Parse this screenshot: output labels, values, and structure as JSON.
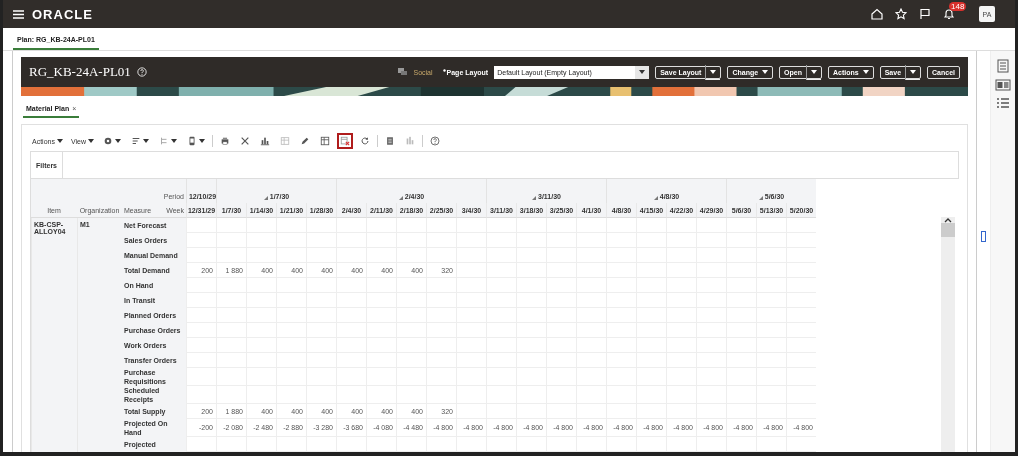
{
  "topbar": {
    "logo": "ORACLE",
    "notification_count": "148",
    "avatar": "PA"
  },
  "plan_tab": {
    "label": "Plan: RG_KB-24A-PL01",
    "selected": true
  },
  "header": {
    "title": "RG_KB-24A-PL01",
    "social": "Social",
    "page_layout": {
      "label": "Page Layout",
      "required": true,
      "value": "Default Layout (Empty Layout)"
    },
    "buttons": [
      {
        "label": "Save Layout",
        "kind": "split"
      },
      {
        "label": "Change",
        "kind": "menu"
      },
      {
        "label": "Open",
        "kind": "split"
      },
      {
        "label": "Actions",
        "kind": "menu"
      },
      {
        "label": "Save",
        "kind": "split"
      },
      {
        "label": "Cancel",
        "kind": "plain"
      }
    ]
  },
  "content_tab": {
    "label": "Material Plan",
    "close": "×",
    "selected": true
  },
  "toolbar": {
    "menus": [
      {
        "label": "Actions"
      },
      {
        "label": "View"
      }
    ],
    "icons": [
      {
        "highlighted": false
      },
      {
        "highlighted": false
      },
      {
        "highlighted": false
      },
      {
        "highlighted": false
      },
      {
        "highlighted": false
      },
      {
        "highlighted": false
      },
      {
        "highlighted": false
      },
      {
        "highlighted": false
      },
      {
        "highlighted": false
      },
      {
        "highlighted": false
      },
      {
        "highlighted": true
      },
      {
        "highlighted": false
      },
      {
        "highlighted": false
      },
      {
        "highlighted": false
      },
      {
        "highlighted": false
      }
    ]
  },
  "filters": {
    "label": "Filters"
  },
  "table": {
    "period_label": "Period",
    "columns": [
      "Item",
      "Organization",
      "Measure",
      "Week"
    ],
    "periods": [
      {
        "label": "12/10/29",
        "weeks": [
          "12/31/29"
        ]
      },
      {
        "label": "1/7/30",
        "weeks": [
          "1/7/30",
          "1/14/30",
          "1/21/30",
          "1/28/30"
        ]
      },
      {
        "label": "2/4/30",
        "weeks": [
          "2/4/30",
          "2/11/30",
          "2/18/30",
          "2/25/30",
          "3/4/30"
        ]
      },
      {
        "label": "3/11/30",
        "weeks": [
          "3/11/30",
          "3/18/30",
          "3/25/30",
          "4/1/30"
        ]
      },
      {
        "label": "4/8/30",
        "weeks": [
          "4/8/30",
          "4/15/30",
          "4/22/30",
          "4/29/30"
        ]
      },
      {
        "label": "5/6/30",
        "weeks": [
          "5/6/30",
          "5/13/30",
          "5/20/30"
        ]
      }
    ],
    "item": "KB-CSP-ALLOY04",
    "organization": "M1",
    "measures": [
      {
        "name": "Net Forecast"
      },
      {
        "name": "Sales Orders"
      },
      {
        "name": "Manual Demand"
      },
      {
        "name": "Total Demand",
        "values": [
          "200",
          "1 880",
          "400",
          "400",
          "400",
          "400",
          "400",
          "400",
          "320"
        ]
      },
      {
        "name": "On Hand"
      },
      {
        "name": "In Transit"
      },
      {
        "name": "Planned Orders"
      },
      {
        "name": "Purchase Orders"
      },
      {
        "name": "Work Orders"
      },
      {
        "name": "Transfer Orders"
      },
      {
        "name": "Purchase Requisitions"
      },
      {
        "name": "Scheduled Receipts"
      },
      {
        "name": "Total Supply",
        "values": [
          "200",
          "1 880",
          "400",
          "400",
          "400",
          "400",
          "400",
          "400",
          "320"
        ]
      },
      {
        "name": "Projected On Hand",
        "values": [
          "-200",
          "-2 080",
          "-2 480",
          "-2 880",
          "-3 280",
          "-3 680",
          "-4 080",
          "-4 480",
          "-4 800",
          "-4 800",
          "-4 800",
          "-4 800",
          "-4 800",
          "-4 800",
          "-4 800",
          "-4 800",
          "-4 800",
          "-4 800",
          "-4 800",
          "-4 800",
          "-4 800"
        ]
      },
      {
        "name": "Projected"
      }
    ]
  }
}
